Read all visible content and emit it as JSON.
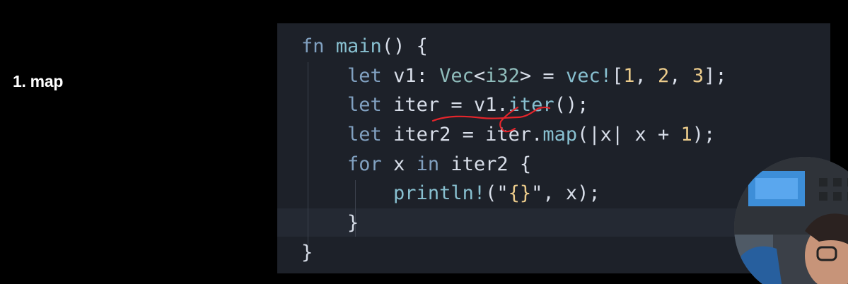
{
  "slide": {
    "title": "1. map"
  },
  "code_editor": {
    "lines": [
      [
        {
          "t": "fn",
          "c": "kw"
        },
        {
          "t": " ",
          "c": "txt"
        },
        {
          "t": "main",
          "c": "fn"
        },
        {
          "t": "() {",
          "c": "txt"
        }
      ],
      [
        {
          "t": "    ",
          "c": "txt"
        },
        {
          "t": "let",
          "c": "kw"
        },
        {
          "t": " v1: ",
          "c": "txt"
        },
        {
          "t": "Vec",
          "c": "ty"
        },
        {
          "t": "<",
          "c": "txt"
        },
        {
          "t": "i32",
          "c": "ty"
        },
        {
          "t": "> = ",
          "c": "txt"
        },
        {
          "t": "vec!",
          "c": "fn"
        },
        {
          "t": "[",
          "c": "txt"
        },
        {
          "t": "1",
          "c": "num"
        },
        {
          "t": ", ",
          "c": "txt"
        },
        {
          "t": "2",
          "c": "num"
        },
        {
          "t": ", ",
          "c": "txt"
        },
        {
          "t": "3",
          "c": "num"
        },
        {
          "t": "];",
          "c": "txt"
        }
      ],
      [
        {
          "t": "    ",
          "c": "txt"
        },
        {
          "t": "let",
          "c": "kw"
        },
        {
          "t": " iter = v1.",
          "c": "txt"
        },
        {
          "t": "iter",
          "c": "fn"
        },
        {
          "t": "();",
          "c": "txt"
        }
      ],
      [
        {
          "t": "    ",
          "c": "txt"
        },
        {
          "t": "let",
          "c": "kw"
        },
        {
          "t": " iter2 = iter.",
          "c": "txt"
        },
        {
          "t": "map",
          "c": "fn"
        },
        {
          "t": "(|x| x + ",
          "c": "txt"
        },
        {
          "t": "1",
          "c": "num"
        },
        {
          "t": ");",
          "c": "txt"
        }
      ],
      [
        {
          "t": "    ",
          "c": "txt"
        },
        {
          "t": "for",
          "c": "kw"
        },
        {
          "t": " x ",
          "c": "txt"
        },
        {
          "t": "in",
          "c": "kw"
        },
        {
          "t": " iter2 {",
          "c": "txt"
        }
      ],
      [
        {
          "t": "        ",
          "c": "txt"
        },
        {
          "t": "println!",
          "c": "fn"
        },
        {
          "t": "(\"",
          "c": "txt"
        },
        {
          "t": "{}",
          "c": "num"
        },
        {
          "t": "\", x);",
          "c": "txt"
        }
      ],
      [
        {
          "t": "    }",
          "c": "txt"
        }
      ],
      [
        {
          "t": "}",
          "c": "txt"
        }
      ]
    ]
  },
  "colors": {
    "keyword": "#81a1c1",
    "function": "#88c0d0",
    "type": "#8fbcbb",
    "number": "#ebcb8b",
    "text": "#d8dee9",
    "annotation": "#e5252b",
    "editor_background": "#1d2129"
  },
  "webcam": {
    "icon": "presenter-video"
  }
}
